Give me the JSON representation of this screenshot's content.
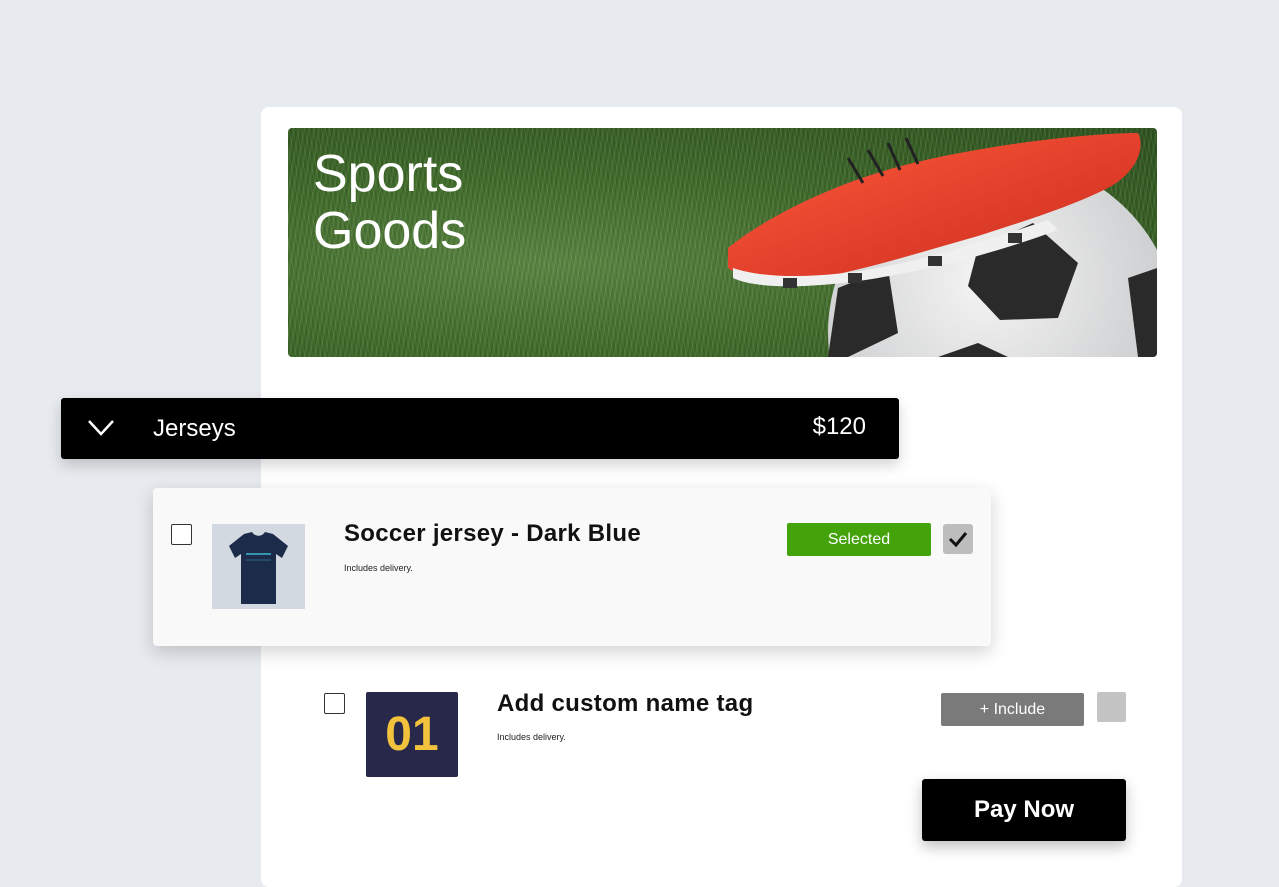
{
  "banner": {
    "title_line1": "Sports",
    "title_line2": "Goods"
  },
  "category": {
    "name": "Jerseys",
    "price": "$120",
    "icon": "chevron-down-icon"
  },
  "items": [
    {
      "title": "Soccer jersey - Dark Blue",
      "subtitle": "Includes delivery.",
      "status_label": "Selected",
      "checked": true
    },
    {
      "title": "Add custom name tag",
      "subtitle": "Includes delivery.",
      "tile_number": "01",
      "action_label": "+ Include",
      "checked": false
    }
  ],
  "checkout": {
    "pay_label": "Pay Now"
  },
  "colors": {
    "selected_green": "#44a30a",
    "tile_navy": "#28294a",
    "tile_number_yellow": "#f2c23c",
    "boot_red": "#e8402e"
  }
}
